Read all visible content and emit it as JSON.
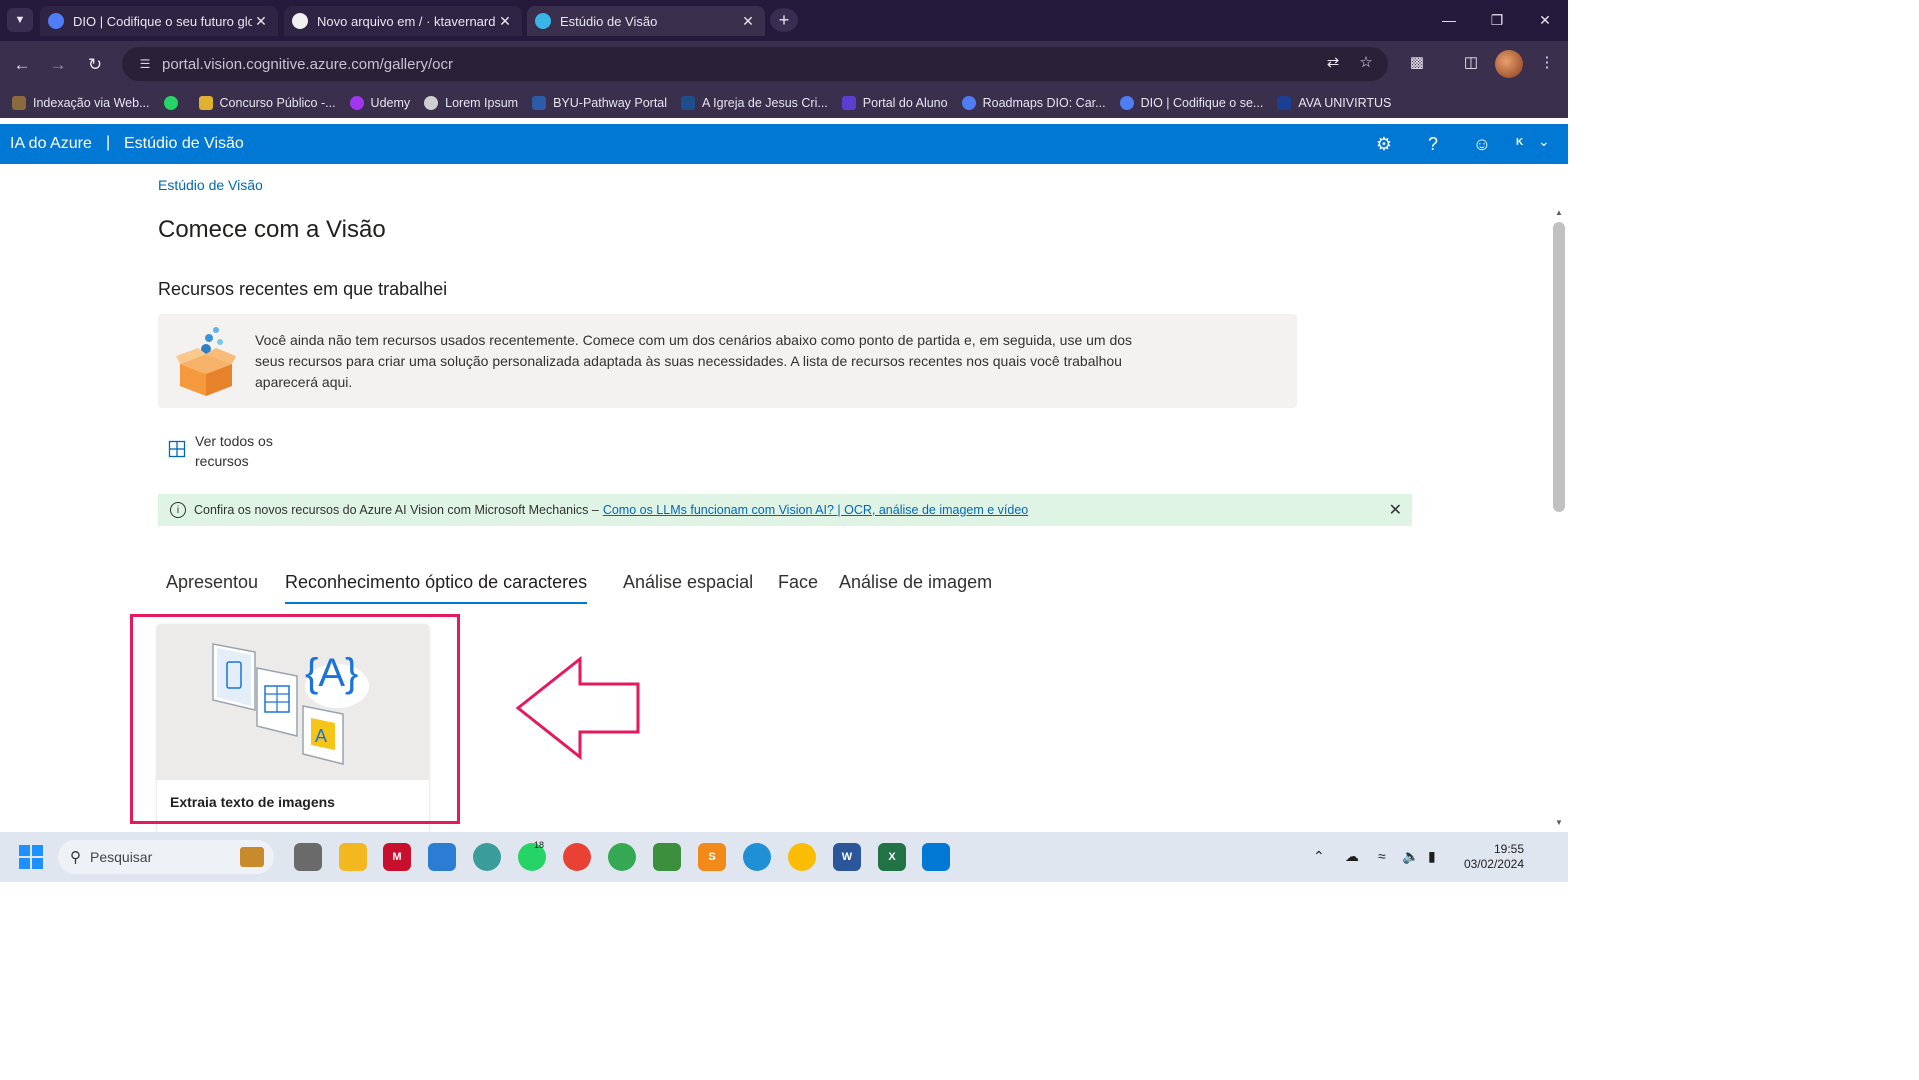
{
  "browser": {
    "tabs": [
      {
        "title": "DIO | Codifique o seu futuro glo",
        "favicon": "dio-icon",
        "color": "#4f7df5"
      },
      {
        "title": "Novo arquivo em / · ktavernard",
        "favicon": "github-icon",
        "color": "#f0f0f0"
      },
      {
        "title": "Estúdio de Visão",
        "favicon": "azure-vision-icon",
        "color": "#38b6e8",
        "active": true
      }
    ],
    "url": "portal.vision.cognitive.azure.com/gallery/ocr",
    "bookmarks": [
      {
        "label": "Indexação via Web...",
        "color": "#8b6a3e"
      },
      {
        "label": "",
        "color": "#25d366"
      },
      {
        "label": "Concurso Público -...",
        "color": "#e0b030"
      },
      {
        "label": "Udemy",
        "color": "#a435f0"
      },
      {
        "label": "Lorem Ipsum",
        "color": "#cfcfcf"
      },
      {
        "label": "BYU-Pathway Portal",
        "color": "#2b5ca8"
      },
      {
        "label": "A Igreja de Jesus Cri...",
        "color": "#1f4e8c"
      },
      {
        "label": "Portal do Aluno",
        "color": "#5a3fd0"
      },
      {
        "label": "Roadmaps DIO: Car...",
        "color": "#4f7df5"
      },
      {
        "label": "DIO | Codifique o se...",
        "color": "#4f7df5"
      },
      {
        "label": "AVA UNIVIRTUS",
        "color": "#1c3f94"
      }
    ]
  },
  "azure": {
    "brand": "IA do Azure",
    "separator": "|",
    "studio": "Estúdio de Visão",
    "user_initial": "K"
  },
  "page": {
    "breadcrumb": "Estúdio de Visão",
    "title": "Comece com a Visão",
    "recent_title": "Recursos recentes em que trabalhei",
    "recent_text": "Você ainda não tem recursos usados recentemente. Comece com um dos cenários abaixo como ponto de partida e, em seguida, use um dos seus recursos para criar uma solução personalizada adaptada às suas necessidades. A lista de recursos recentes nos quais você trabalhou aparecerá aqui.",
    "see_all": "Ver todos os recursos",
    "banner_text": "Confira os novos recursos do Azure AI Vision com Microsoft Mechanics –",
    "banner_link": "Como os LLMs funcionam com Vision AI? | OCR, análise de imagem e vídeo",
    "tabs": [
      "Apresentou",
      "Reconhecimento óptico de caracteres",
      "Análise espacial",
      "Face",
      "Análise de imagem"
    ],
    "selected_tab": "Reconhecimento óptico de caracteres",
    "card_title": "Extraia texto de imagens",
    "highlight_color": "#e6195f"
  },
  "taskbar": {
    "search_placeholder": "Pesquisar",
    "whatsapp_badge": "18",
    "time": "19:55",
    "date": "03/02/2024"
  }
}
